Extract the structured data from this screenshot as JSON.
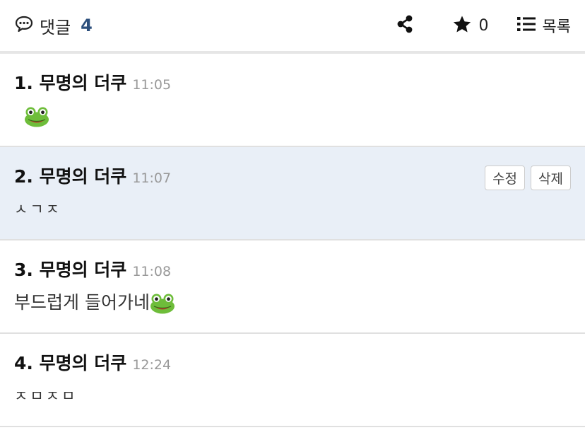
{
  "header": {
    "title": "댓글",
    "count": "4",
    "star_count": "0",
    "list_label": "목록",
    "icons": [
      "comment-icon",
      "share-icon",
      "star-icon",
      "list-icon"
    ]
  },
  "comments": [
    {
      "author": "1. 무명의 더쿠",
      "time": "11:05",
      "text": "",
      "emoji": "frog-face-icon"
    },
    {
      "author": "2. 무명의 더쿠",
      "time": "11:07",
      "text": "ㅅㄱㅈ",
      "edit_label": "수정",
      "delete_label": "삭제",
      "highlighted": true
    },
    {
      "author": "3. 무명의 더쿠",
      "time": "11:08",
      "text": "부드럽게 들어가네",
      "emoji": "frog-face-icon"
    },
    {
      "author": "4. 무명의 더쿠",
      "time": "12:24",
      "text": "ㅈㅁㅈㅁ"
    }
  ],
  "colors": {
    "accent": "#2c4f7c",
    "highlight_bg": "#e9eff7",
    "frog_green": "#6ebd3a"
  }
}
